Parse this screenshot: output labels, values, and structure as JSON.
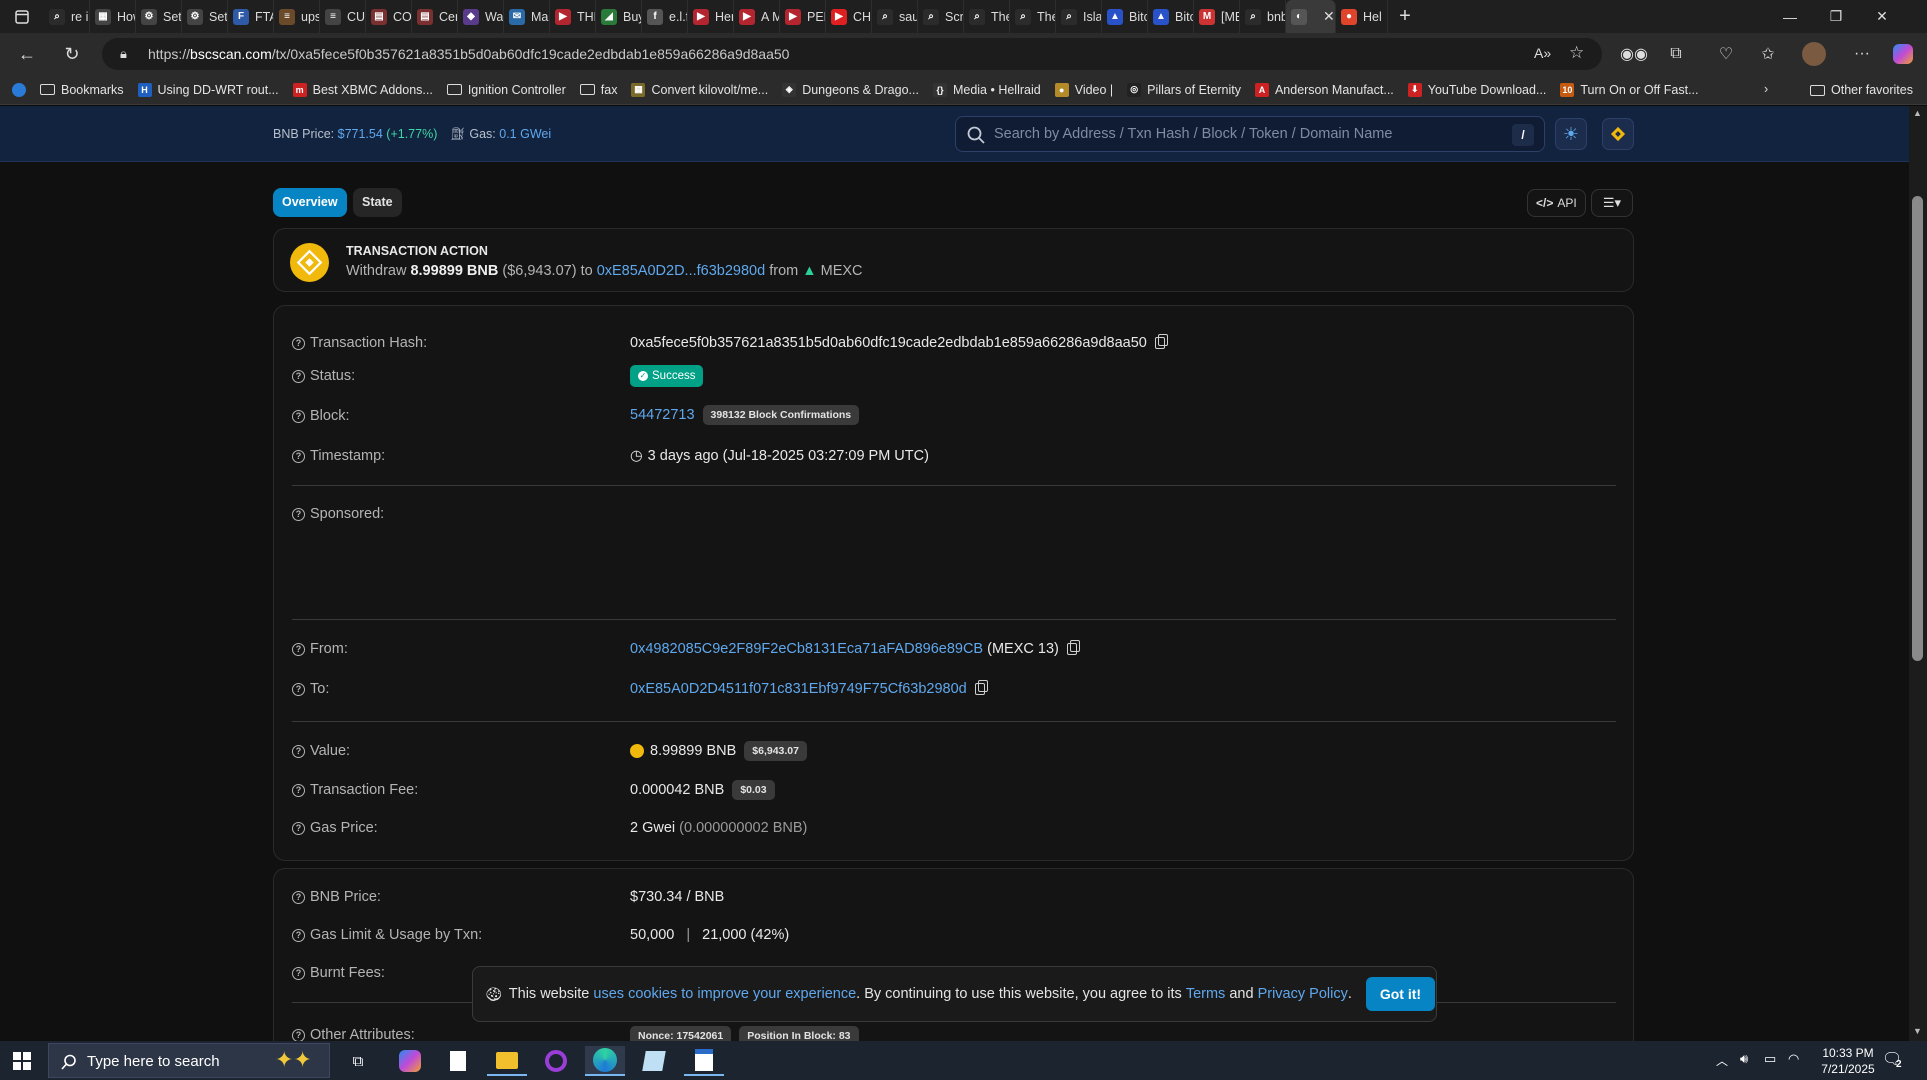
{
  "browser": {
    "tabs": [
      {
        "label": "re in",
        "color": "#2b2b2b",
        "glyph": "⌕"
      },
      {
        "label": "How",
        "color": "#444",
        "glyph": "▦"
      },
      {
        "label": "Setti",
        "color": "#444",
        "glyph": "⚙"
      },
      {
        "label": "Setti",
        "color": "#444",
        "glyph": "⚙"
      },
      {
        "label": "FTA",
        "color": "#2f5aa8",
        "glyph": "F"
      },
      {
        "label": "ups-",
        "color": "#6b4a2a",
        "glyph": "≡"
      },
      {
        "label": "CUS",
        "color": "#444",
        "glyph": "≡"
      },
      {
        "label": "COI",
        "color": "#7a3030",
        "glyph": "▤"
      },
      {
        "label": "Cert",
        "color": "#7a3030",
        "glyph": "▤"
      },
      {
        "label": "Wat",
        "color": "#5a3a8a",
        "glyph": "◆"
      },
      {
        "label": "Mail",
        "color": "#2a6aa8",
        "glyph": "✉"
      },
      {
        "label": "THE",
        "color": "#b3262f",
        "glyph": "▶"
      },
      {
        "label": "Buyi",
        "color": "#2a7a3a",
        "glyph": "◢"
      },
      {
        "label": "e.l.f.",
        "color": "#555",
        "glyph": "f"
      },
      {
        "label": "Here",
        "color": "#b3262f",
        "glyph": "▶"
      },
      {
        "label": "A M",
        "color": "#b3262f",
        "glyph": "▶"
      },
      {
        "label": "PEN",
        "color": "#b3262f",
        "glyph": "▶"
      },
      {
        "label": "CHC",
        "color": "#e02020",
        "glyph": "▶"
      },
      {
        "label": "saul",
        "color": "#2b2b2b",
        "glyph": "⌕"
      },
      {
        "label": "Scri",
        "color": "#2b2b2b",
        "glyph": "⌕"
      },
      {
        "label": "The",
        "color": "#2b2b2b",
        "glyph": "⌕"
      },
      {
        "label": "The",
        "color": "#2b2b2b",
        "glyph": "⌕"
      },
      {
        "label": "Islar",
        "color": "#2b2b2b",
        "glyph": "⌕"
      },
      {
        "label": "Bitc",
        "color": "#2a52c8",
        "glyph": "▲"
      },
      {
        "label": "Bitc",
        "color": "#2a52c8",
        "glyph": "▲"
      },
      {
        "label": "[ME",
        "color": "#c33",
        "glyph": "M"
      },
      {
        "label": "bnb",
        "color": "#2b2b2b",
        "glyph": "⌕"
      },
      {
        "label": "",
        "color": "#555",
        "glyph": "◐",
        "active": true
      },
      {
        "label": "Hel",
        "color": "#e0442a",
        "glyph": "●"
      }
    ],
    "url_prefix": "https://",
    "url_domain": "bscscan.com",
    "url_path": "/tx/0xa5fece5f0b357621a8351b5d0ab60dfc19cade2edbdab1e859a66286a9d8aa50",
    "bookmarks": [
      {
        "label": "Bookmarks",
        "type": "folder"
      },
      {
        "label": "Using DD-WRT rout...",
        "color": "#1f5fbf",
        "glyph": "H"
      },
      {
        "label": "Best XBMC Addons...",
        "color": "#c22",
        "glyph": "m"
      },
      {
        "label": "Ignition Controller",
        "type": "folder"
      },
      {
        "label": "fax",
        "type": "folder"
      },
      {
        "label": "Convert kilovolt/me...",
        "color": "#7a6a2a",
        "glyph": "▦"
      },
      {
        "label": "Dungeons & Drago...",
        "color": "#333",
        "glyph": "◈"
      },
      {
        "label": "Media • Hellraid",
        "color": "#333",
        "glyph": "{}"
      },
      {
        "label": "Video |",
        "color": "#b58b2a",
        "glyph": "●"
      },
      {
        "label": "Pillars of Eternity",
        "color": "#222",
        "glyph": "◎"
      },
      {
        "label": "Anderson Manufact...",
        "color": "#c22",
        "glyph": "A"
      },
      {
        "label": "YouTube Download...",
        "color": "#c22",
        "glyph": "⬇"
      },
      {
        "label": "Turn On or Off Fast...",
        "color": "#c55a11",
        "glyph": "10"
      }
    ],
    "other_favorites": "Other favorites"
  },
  "header": {
    "bnb_price_label": "BNB Price:",
    "bnb_price_value": "$771.54",
    "bnb_price_change": "(+1.77%)",
    "gas_label": "Gas:",
    "gas_value": "0.1 GWei",
    "search_placeholder": "Search by Address / Txn Hash / Block / Token / Domain Name",
    "search_shortcut": "/"
  },
  "tabs": {
    "overview": "Overview",
    "state": "State",
    "api": "API"
  },
  "action": {
    "title": "TRANSACTION ACTION",
    "verb": "Withdraw",
    "amount": "8.99899 BNB",
    "usd": "($6,943.07)",
    "to_word": "to",
    "to_addr": "0xE85A0D2D...f63b2980d",
    "from_word": "from",
    "exchange": "MEXC"
  },
  "details": {
    "tx_hash_label": "Transaction Hash:",
    "tx_hash": "0xa5fece5f0b357621a8351b5d0ab60dfc19cade2edbdab1e859a66286a9d8aa50",
    "status_label": "Status:",
    "status": "Success",
    "block_label": "Block:",
    "block": "54472713",
    "confirmations": "398132 Block Confirmations",
    "timestamp_label": "Timestamp:",
    "timestamp": "3 days ago (Jul-18-2025 03:27:09 PM UTC)",
    "sponsored_label": "Sponsored:",
    "from_label": "From:",
    "from_addr": "0x4982085C9e2F89F2eCb8131Eca71aFAD896e89CB",
    "from_tag": "(MEXC 13)",
    "to_label": "To:",
    "to_addr": "0xE85A0D2D4511f071c831Ebf9749F75Cf63b2980d",
    "value_label": "Value:",
    "value": "8.99899 BNB",
    "value_usd": "$6,943.07",
    "fee_label": "Transaction Fee:",
    "fee": "0.000042 BNB",
    "fee_usd": "$0.03",
    "gas_price_label": "Gas Price:",
    "gas_price": "2 Gwei",
    "gas_price_bnb": "(0.000000002 BNB)"
  },
  "more": {
    "bnb_price_label": "BNB Price:",
    "bnb_price": "$730.34 / BNB",
    "gas_limit_label": "Gas Limit & Usage by Txn:",
    "gas_limit": "50,000",
    "gas_sep": "|",
    "gas_usage": "21,000 (42%)",
    "burnt_label": "Burnt Fees:",
    "other_label": "Other Attributes:",
    "nonce": "Nonce: 17542061",
    "position": "Position In Block: 83"
  },
  "cookie": {
    "text_1": "This website",
    "link_1": "uses cookies to improve your experience",
    "text_2": ". By continuing to use this website, you agree to its",
    "link_2": "Terms",
    "text_3": "and",
    "link_3": "Privacy Policy",
    "text_4": ".",
    "button": "Got it!"
  },
  "taskbar": {
    "search_placeholder": "Type here to search",
    "time": "10:33 PM",
    "date": "7/21/2025",
    "notification_count": "2"
  },
  "colors": {
    "accent_blue": "#0784c3",
    "link": "#5fa8ee",
    "success_green": "#00a186",
    "bnb_yellow": "#f0b90b",
    "header_bg": "#12233f"
  }
}
